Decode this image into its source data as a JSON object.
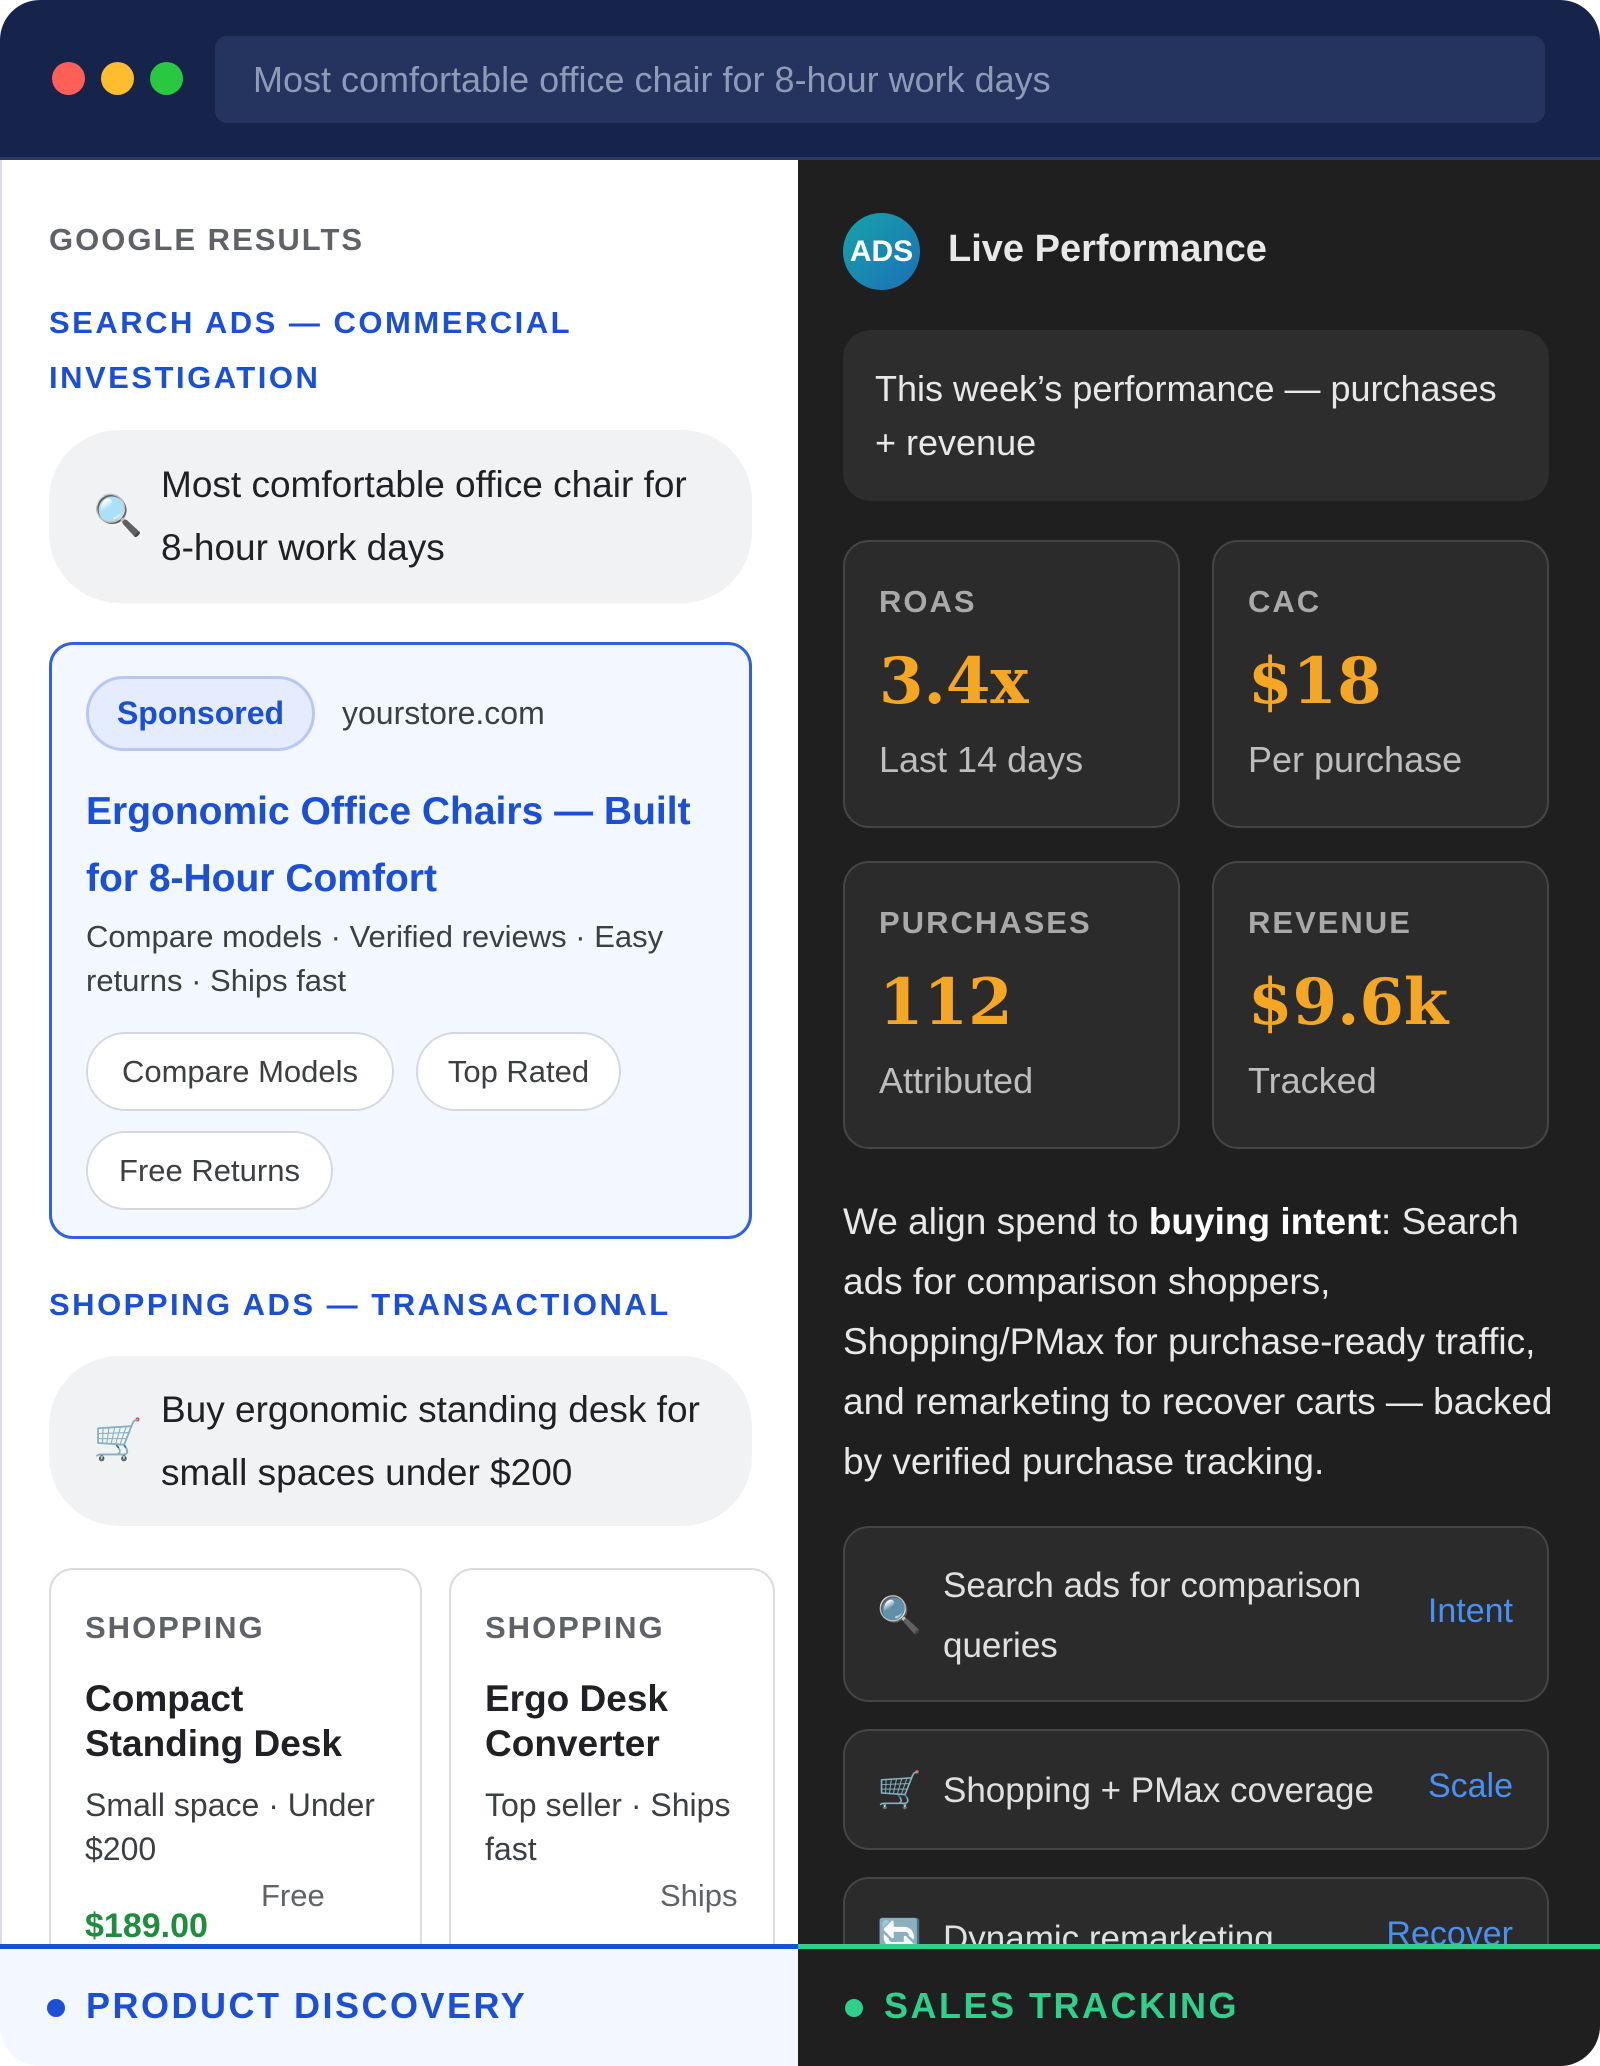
{
  "browser": {
    "address": "Most comfortable office chair for 8-hour work days"
  },
  "left": {
    "section_title": "GOOGLE RESULTS",
    "search_ads_label": "SEARCH ADS — COMMERCIAL INVESTIGATION",
    "search_query": {
      "icon": "search-icon",
      "text": "Most comfortable office chair for 8-hour work days"
    },
    "ad": {
      "badge": "Sponsored",
      "domain": "yourstore.com",
      "headline": "Ergonomic Office Chairs — Built for 8-Hour Comfort",
      "description": "Compare models · Verified reviews · Easy returns · Ships fast",
      "chips": [
        "Compare Models",
        "Top Rated",
        "Free Returns"
      ]
    },
    "shopping_ads_label": "SHOPPING ADS — TRANSACTIONAL",
    "shopping_query": {
      "icon": "cart-icon",
      "text": "Buy ergonomic standing desk for small spaces under $200"
    },
    "products": [
      {
        "kicker": "SHOPPING",
        "title": "Compact Standing Desk",
        "desc": "Small space · Under $200",
        "price": "$189.00",
        "note": "Free"
      },
      {
        "kicker": "SHOPPING",
        "title": "Ergo Desk Converter",
        "desc": "Top seller · Ships fast",
        "note": "Ships"
      }
    ]
  },
  "right": {
    "logo_text": "ADS",
    "title": "Live Performance",
    "week_text": "This week’s performance — purchases + revenue",
    "metrics": [
      {
        "label": "ROAS",
        "value": "3.4x",
        "sub": "Last 14 days"
      },
      {
        "label": "CAC",
        "value": "$18",
        "sub": "Per purchase"
      },
      {
        "label": "PURCHASES",
        "value": "112",
        "sub": "Attributed"
      },
      {
        "label": "REVENUE",
        "value": "$9.6k",
        "sub": "Tracked"
      }
    ],
    "body": {
      "pre": "We align spend to ",
      "bold": "buying intent",
      "post": ": Search ads for comparison shoppers, Shopping/PMax for purchase-ready traffic, and remarketing to recover carts — backed by verified purchase tracking."
    },
    "features": [
      {
        "icon": "search-icon",
        "text": "Search ads for comparison queries",
        "tag": "Intent"
      },
      {
        "icon": "cart-icon",
        "text": "Shopping + PMax coverage",
        "tag": "Scale"
      },
      {
        "icon": "refresh-icon",
        "text": "Dynamic remarketing",
        "tag": "Recover"
      }
    ]
  },
  "footer": {
    "left_label": "PRODUCT DISCOVERY",
    "right_label": "SALES TRACKING"
  },
  "colors": {
    "accent_blue": "#1a4fd6",
    "accent_green": "#2fd08b",
    "metric_orange": "#f5a623",
    "chrome_navy": "#16234a"
  }
}
